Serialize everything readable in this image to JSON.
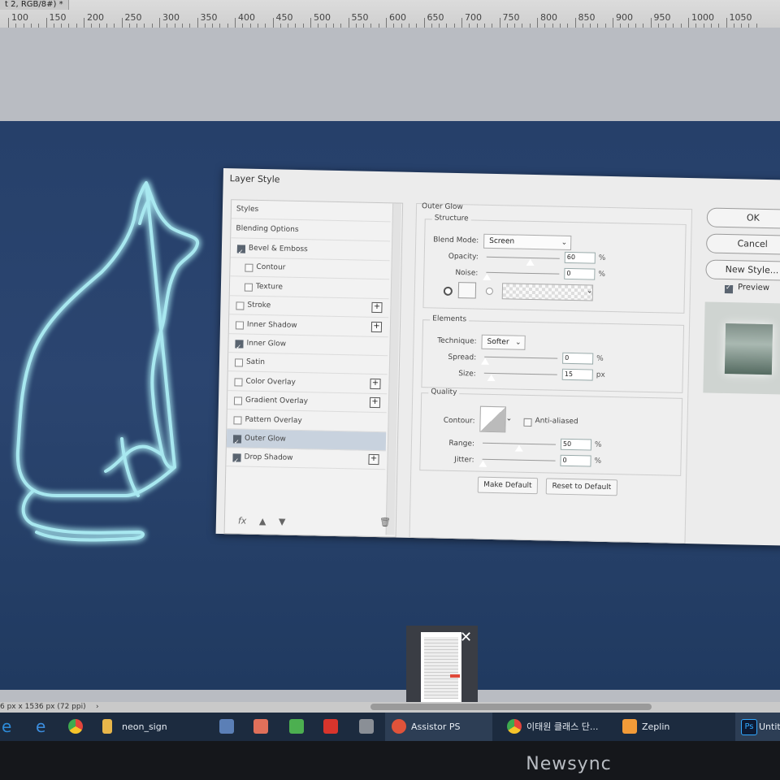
{
  "document": {
    "tab_title": "t 2, RGB/8#) *"
  },
  "ruler": {
    "labels": [
      "100",
      "150",
      "200",
      "250",
      "300",
      "350",
      "400",
      "450",
      "500",
      "550",
      "600",
      "650",
      "700",
      "750",
      "800",
      "850",
      "900",
      "950",
      "1000",
      "1050"
    ]
  },
  "dialog": {
    "title": "Layer Style",
    "styles_list": [
      {
        "label": "Styles",
        "checkbox": false,
        "checked": false,
        "plus": false,
        "selected": false
      },
      {
        "label": "Blending Options",
        "checkbox": false,
        "checked": false,
        "plus": false,
        "selected": false
      },
      {
        "label": "Bevel & Emboss",
        "checkbox": true,
        "checked": true,
        "plus": false,
        "selected": false
      },
      {
        "label": "Contour",
        "checkbox": true,
        "checked": false,
        "plus": false,
        "selected": false,
        "indent": true
      },
      {
        "label": "Texture",
        "checkbox": true,
        "checked": false,
        "plus": false,
        "selected": false,
        "indent": true
      },
      {
        "label": "Stroke",
        "checkbox": true,
        "checked": false,
        "plus": true,
        "selected": false
      },
      {
        "label": "Inner Shadow",
        "checkbox": true,
        "checked": false,
        "plus": true,
        "selected": false
      },
      {
        "label": "Inner Glow",
        "checkbox": true,
        "checked": true,
        "plus": false,
        "selected": false
      },
      {
        "label": "Satin",
        "checkbox": true,
        "checked": false,
        "plus": false,
        "selected": false
      },
      {
        "label": "Color Overlay",
        "checkbox": true,
        "checked": false,
        "plus": true,
        "selected": false
      },
      {
        "label": "Gradient Overlay",
        "checkbox": true,
        "checked": false,
        "plus": true,
        "selected": false
      },
      {
        "label": "Pattern Overlay",
        "checkbox": true,
        "checked": false,
        "plus": false,
        "selected": false
      },
      {
        "label": "Outer Glow",
        "checkbox": true,
        "checked": true,
        "plus": false,
        "selected": true
      },
      {
        "label": "Drop Shadow",
        "checkbox": true,
        "checked": true,
        "plus": true,
        "selected": false
      }
    ],
    "footer_fx": "fx",
    "panel": {
      "title": "Outer Glow",
      "structure": {
        "label": "Structure",
        "blend_mode_label": "Blend Mode:",
        "blend_mode_value": "Screen",
        "opacity_label": "Opacity:",
        "opacity_value": "60",
        "opacity_unit": "%",
        "noise_label": "Noise:",
        "noise_value": "0",
        "noise_unit": "%"
      },
      "elements": {
        "label": "Elements",
        "technique_label": "Technique:",
        "technique_value": "Softer",
        "spread_label": "Spread:",
        "spread_value": "0",
        "spread_unit": "%",
        "size_label": "Size:",
        "size_value": "15",
        "size_unit": "px"
      },
      "quality": {
        "label": "Quality",
        "contour_label": "Contour:",
        "anti_aliased_label": "Anti-aliased",
        "range_label": "Range:",
        "range_value": "50",
        "range_unit": "%",
        "jitter_label": "Jitter:",
        "jitter_value": "0",
        "jitter_unit": "%"
      },
      "make_default": "Make Default",
      "reset_default": "Reset to Default"
    },
    "buttons": {
      "ok": "OK",
      "cancel": "Cancel",
      "new_style": "New Style...",
      "preview": "Preview"
    }
  },
  "status": {
    "text": "6 px x 1536 px (72 ppi)"
  },
  "taskbar": {
    "neon_sign": "neon_sign",
    "assistor": "Assistor PS",
    "chrome": "이태원 클래스 단...",
    "zeplin": "Zeplin",
    "ps": "Untitl"
  },
  "monitor_brand": "Newsync",
  "colors": {
    "canvas": "#26406a",
    "neon": "#a8e8f0",
    "taskbar": "#1c2b3f",
    "selected_row": "#c8d2de"
  }
}
